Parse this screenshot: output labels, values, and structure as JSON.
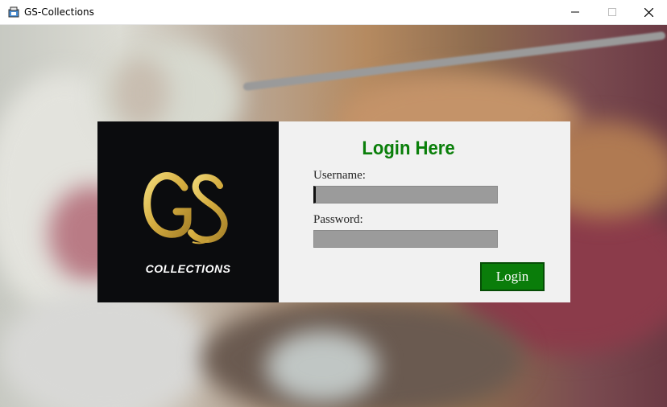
{
  "window": {
    "title": "GS-Collections",
    "icons": [
      "app-icon",
      "minimize-icon",
      "maximize-icon",
      "close-icon"
    ]
  },
  "logo": {
    "monogram": "GS",
    "word": "COLLECTIONS",
    "background": "#0b0c0e",
    "gold": "#d9b94a"
  },
  "login_form": {
    "title": "Login Here",
    "title_color": "#0a7f0a",
    "username_label": "Username:",
    "username_value": "",
    "password_label": "Password:",
    "password_value": "",
    "submit_label": "Login",
    "button_color": "#0a7d0a"
  }
}
